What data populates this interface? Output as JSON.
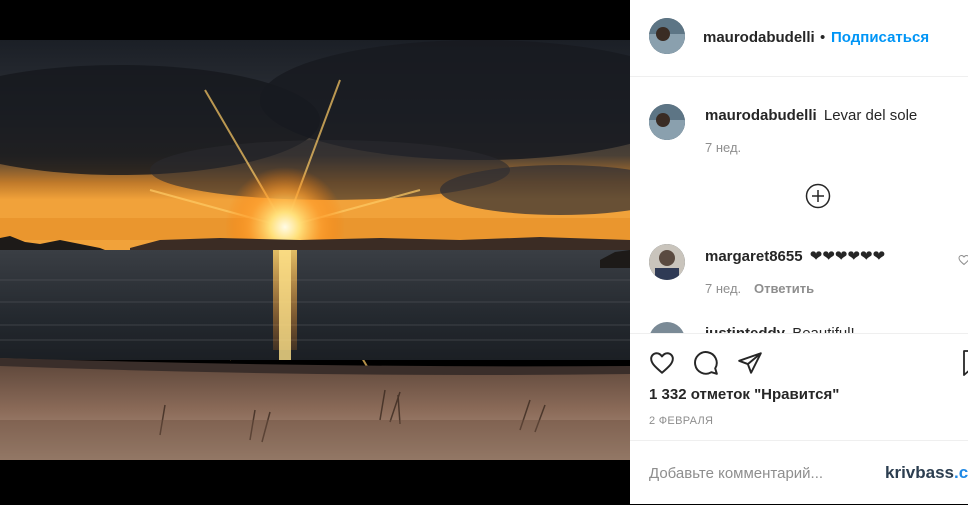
{
  "post": {
    "author": "maurodabudelli",
    "follow_label": "Подписаться",
    "separator": "•",
    "caption": {
      "username": "maurodabudelli",
      "text": "Levar del sole",
      "time": "7 нед."
    },
    "load_more_icon": "plus-circle-icon",
    "comments": [
      {
        "username": "margaret8655",
        "text": "❤❤❤❤❤❤",
        "time": "7 нед.",
        "reply_label": "Ответить"
      },
      {
        "username": "justinteddy",
        "text": "Beautiful!"
      }
    ],
    "likes": "1 332 отметок \"Нравится\"",
    "date": "2 ФЕВРАЛЯ",
    "comment_placeholder": "Добавьте комментарий...",
    "icons": [
      "heart-icon",
      "comment-icon",
      "share-icon",
      "bookmark-icon"
    ]
  },
  "watermark": {
    "main": "krivbass",
    "accent": ".ci"
  },
  "colors": {
    "follow": "#0095f6",
    "muted": "#8e8e8e",
    "text": "#262626"
  }
}
